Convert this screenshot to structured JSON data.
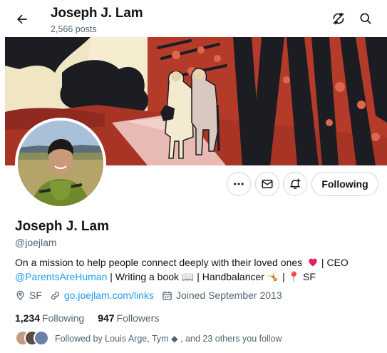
{
  "header": {
    "title": "Joseph J. Lam",
    "posts_count": "2,566 posts"
  },
  "profile": {
    "name": "Joseph J. Lam",
    "handle": "@joejlam",
    "following_button": "Following",
    "bio": {
      "line1_text": "On a mission to help people connect deeply with their loved ones",
      "line1_after": " | CEO",
      "mention": "@ParentsAreHuman",
      "line2_text": " | Writing a book 📖 | Handbalancer 🤸 | 📍 SF"
    },
    "location": "SF",
    "website": "go.joejlam.com/links",
    "joined": "Joined September 2013",
    "following_count": "1,234",
    "following_label": "Following",
    "followers_count": "947",
    "followers_label": "Followers",
    "followed_by": "Followed by Louis Arge, Tym ◆ , and 23 others you follow"
  },
  "icons": [
    "back-arrow-icon",
    "refresh-off-icon",
    "search-icon",
    "more-icon",
    "mail-icon",
    "notification-bell-icon",
    "location-icon",
    "link-icon",
    "calendar-icon",
    "heart-emoji"
  ],
  "colors": {
    "accent": "#1d9bf0",
    "secondary_text": "#536471",
    "banner_red": "#b43a2a",
    "banner_dark": "#1c1d22",
    "banner_cream": "#f4ead0"
  }
}
